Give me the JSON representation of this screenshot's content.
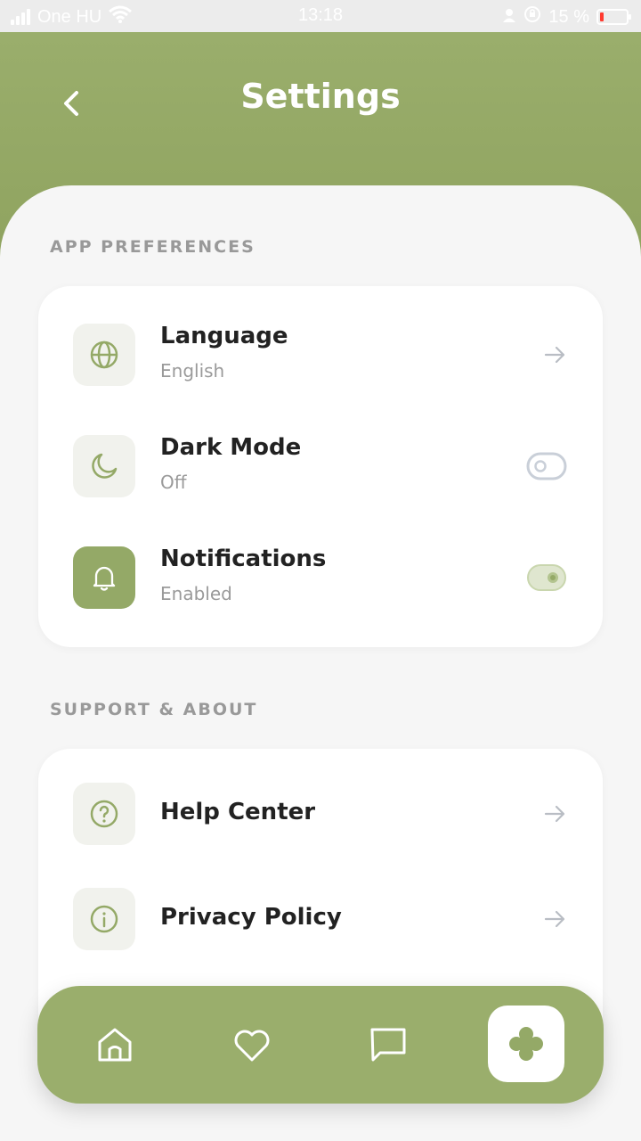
{
  "status_bar": {
    "carrier": "One HU",
    "time": "13:18",
    "battery": "15 %",
    "battery_level": 0.15
  },
  "header": {
    "title": "Settings",
    "back_icon": "chevron-left-icon"
  },
  "sections": {
    "app_preferences": {
      "label": "APP PREFERENCES",
      "items": [
        {
          "title": "Language",
          "subtitle": "English",
          "icon": "globe-icon",
          "control": "arrow"
        },
        {
          "title": "Dark Mode",
          "subtitle": "Off",
          "icon": "moon-icon",
          "control": "toggle-off"
        },
        {
          "title": "Notifications",
          "subtitle": "Enabled",
          "icon": "bell-icon",
          "control": "toggle-on"
        }
      ]
    },
    "support_about": {
      "label": "SUPPORT & ABOUT",
      "items": [
        {
          "title": "Help Center",
          "icon": "question-icon",
          "control": "arrow"
        },
        {
          "title": "Privacy Policy",
          "icon": "info-icon",
          "control": "arrow"
        }
      ]
    }
  },
  "bottom_nav": {
    "items": [
      "home-icon",
      "heart-icon",
      "chat-icon",
      "settings-flower-icon"
    ],
    "active": "settings-flower-icon"
  },
  "colors": {
    "accent": "#94a967",
    "header": "#9aae6c",
    "background": "#f6f6f6",
    "card": "#ffffff"
  }
}
